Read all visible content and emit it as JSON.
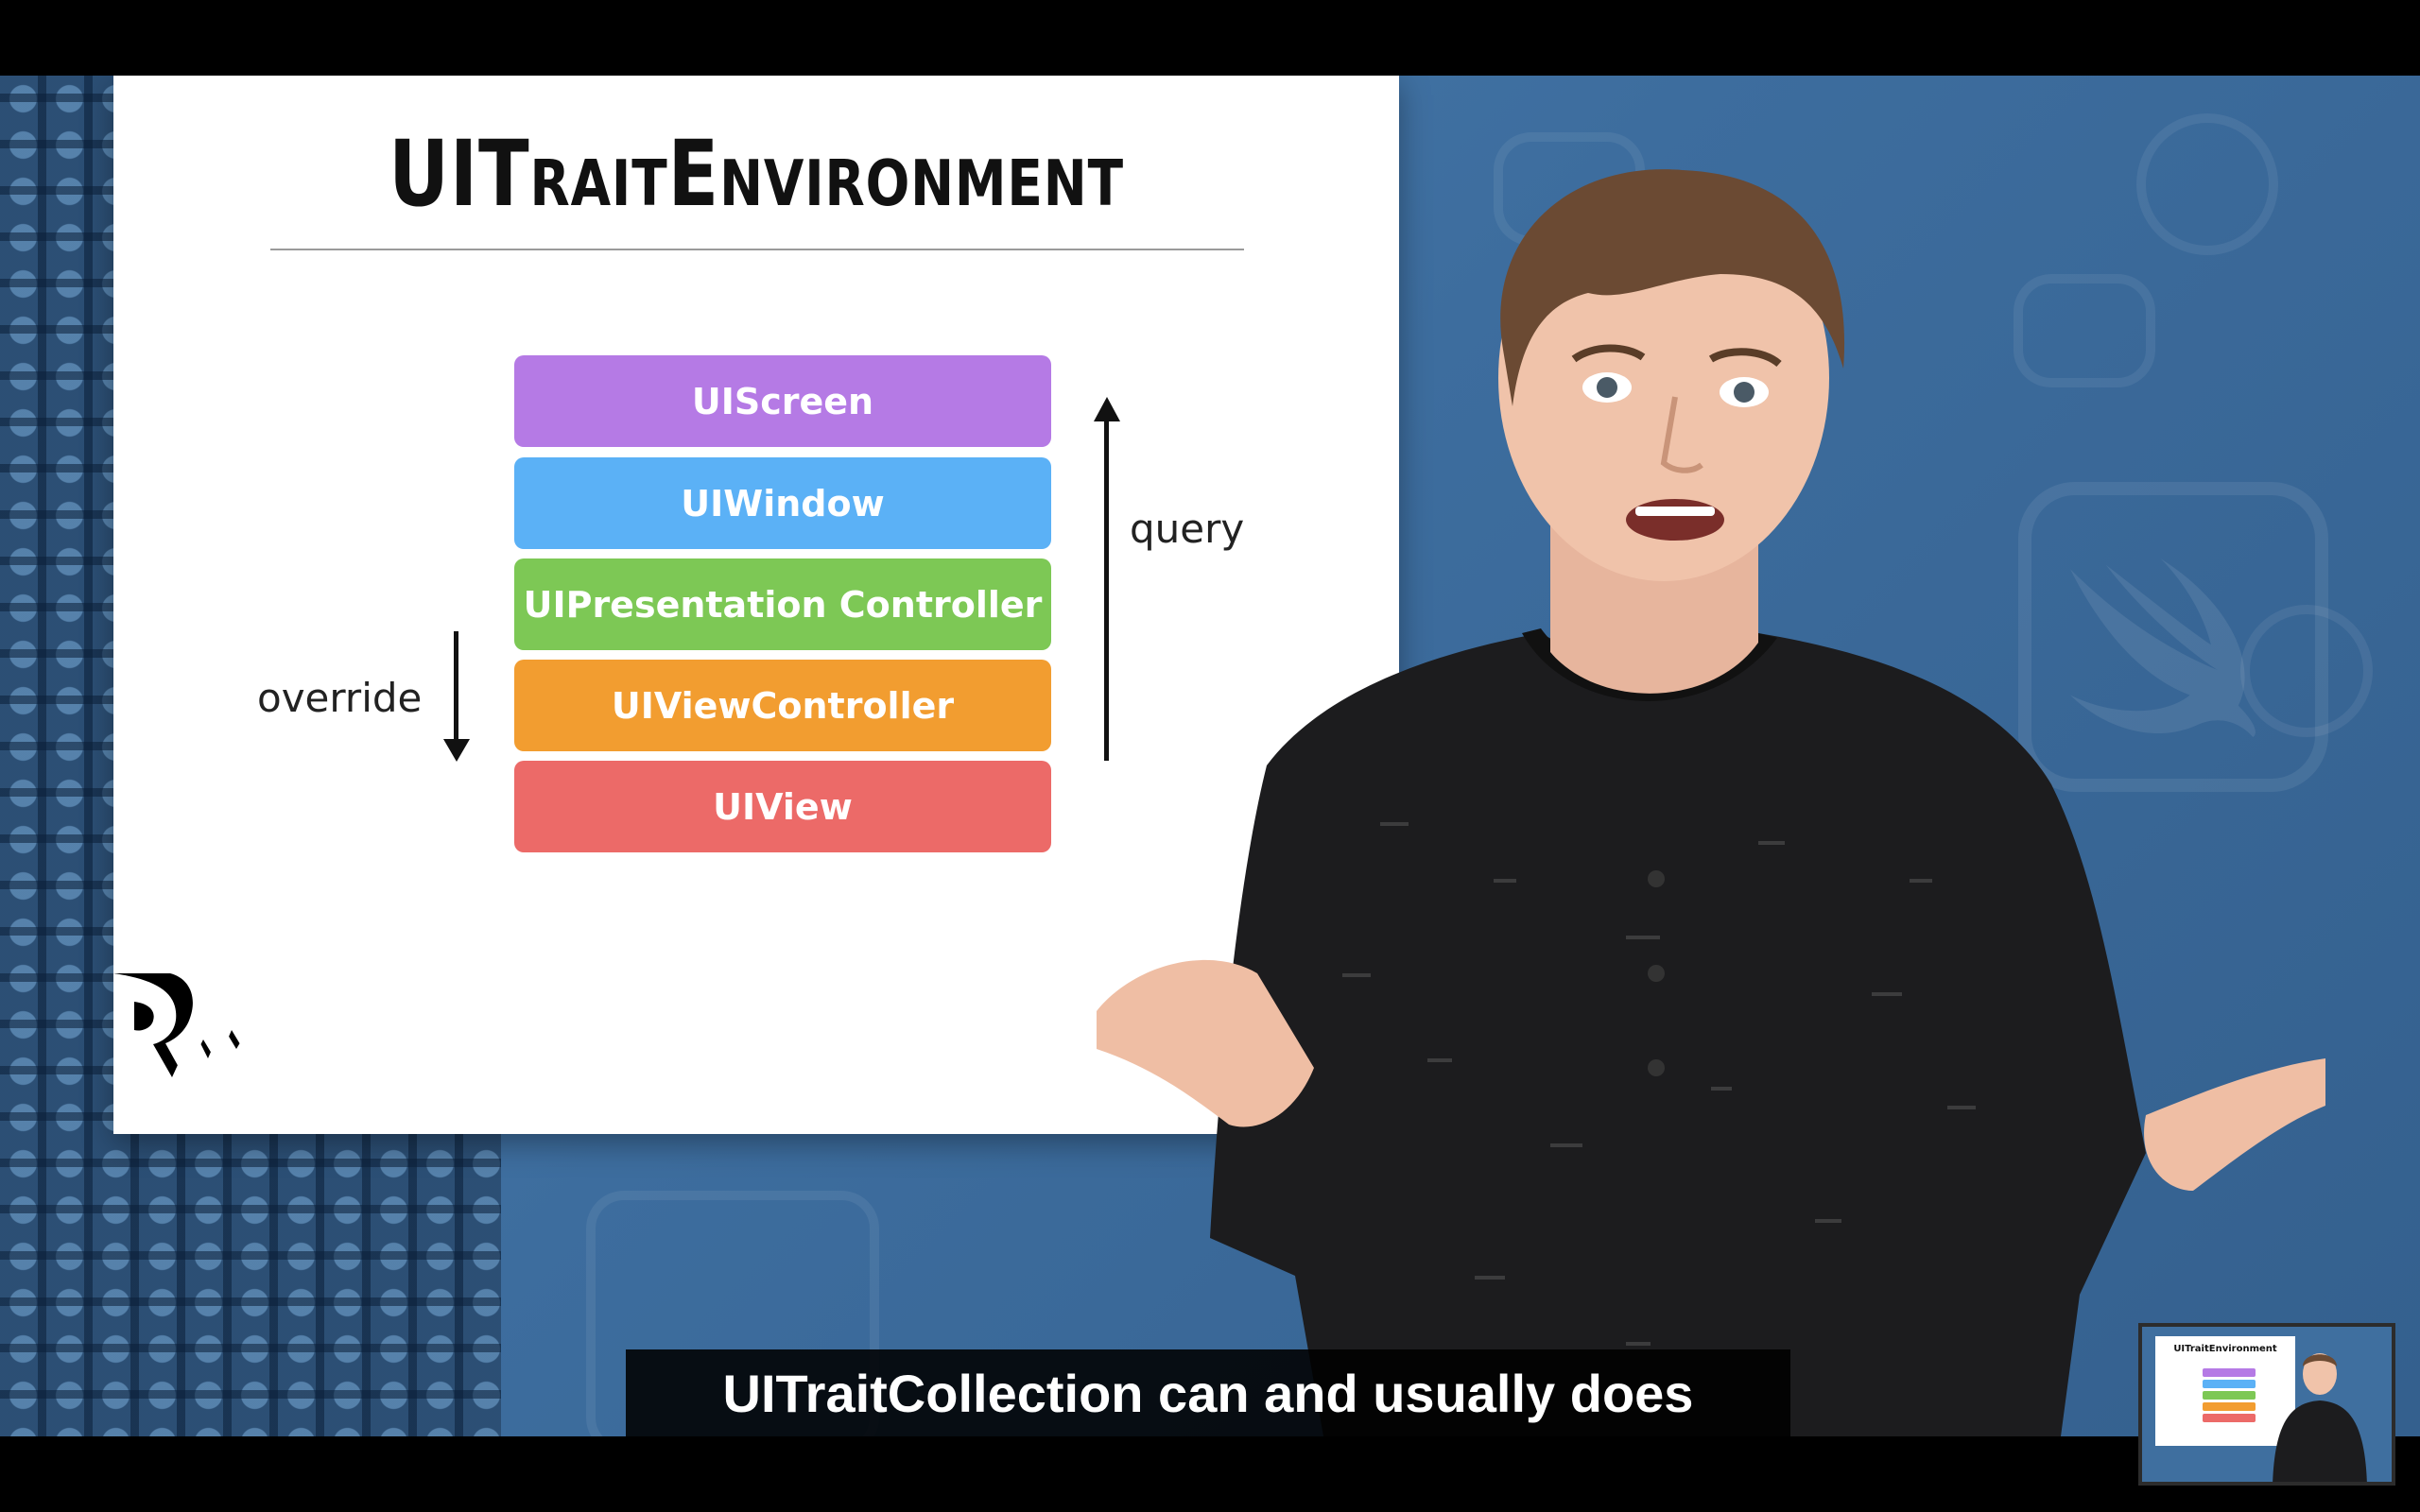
{
  "slide": {
    "title": "UITraitEnvironment",
    "layers": [
      {
        "label": "UIScreen",
        "color": "#b57ae5"
      },
      {
        "label": "UIWindow",
        "color": "#5bb1f6"
      },
      {
        "label": "UIPresentation Controller",
        "color": "#7dc855"
      },
      {
        "label": "UIViewController",
        "color": "#f29d30"
      },
      {
        "label": "UIView",
        "color": "#ec6a68"
      }
    ],
    "override_label": "override",
    "query_label": "query"
  },
  "subtitle": {
    "text": "UITraitCollection can and usually does"
  },
  "pip": {
    "title": "UITraitEnvironment"
  }
}
